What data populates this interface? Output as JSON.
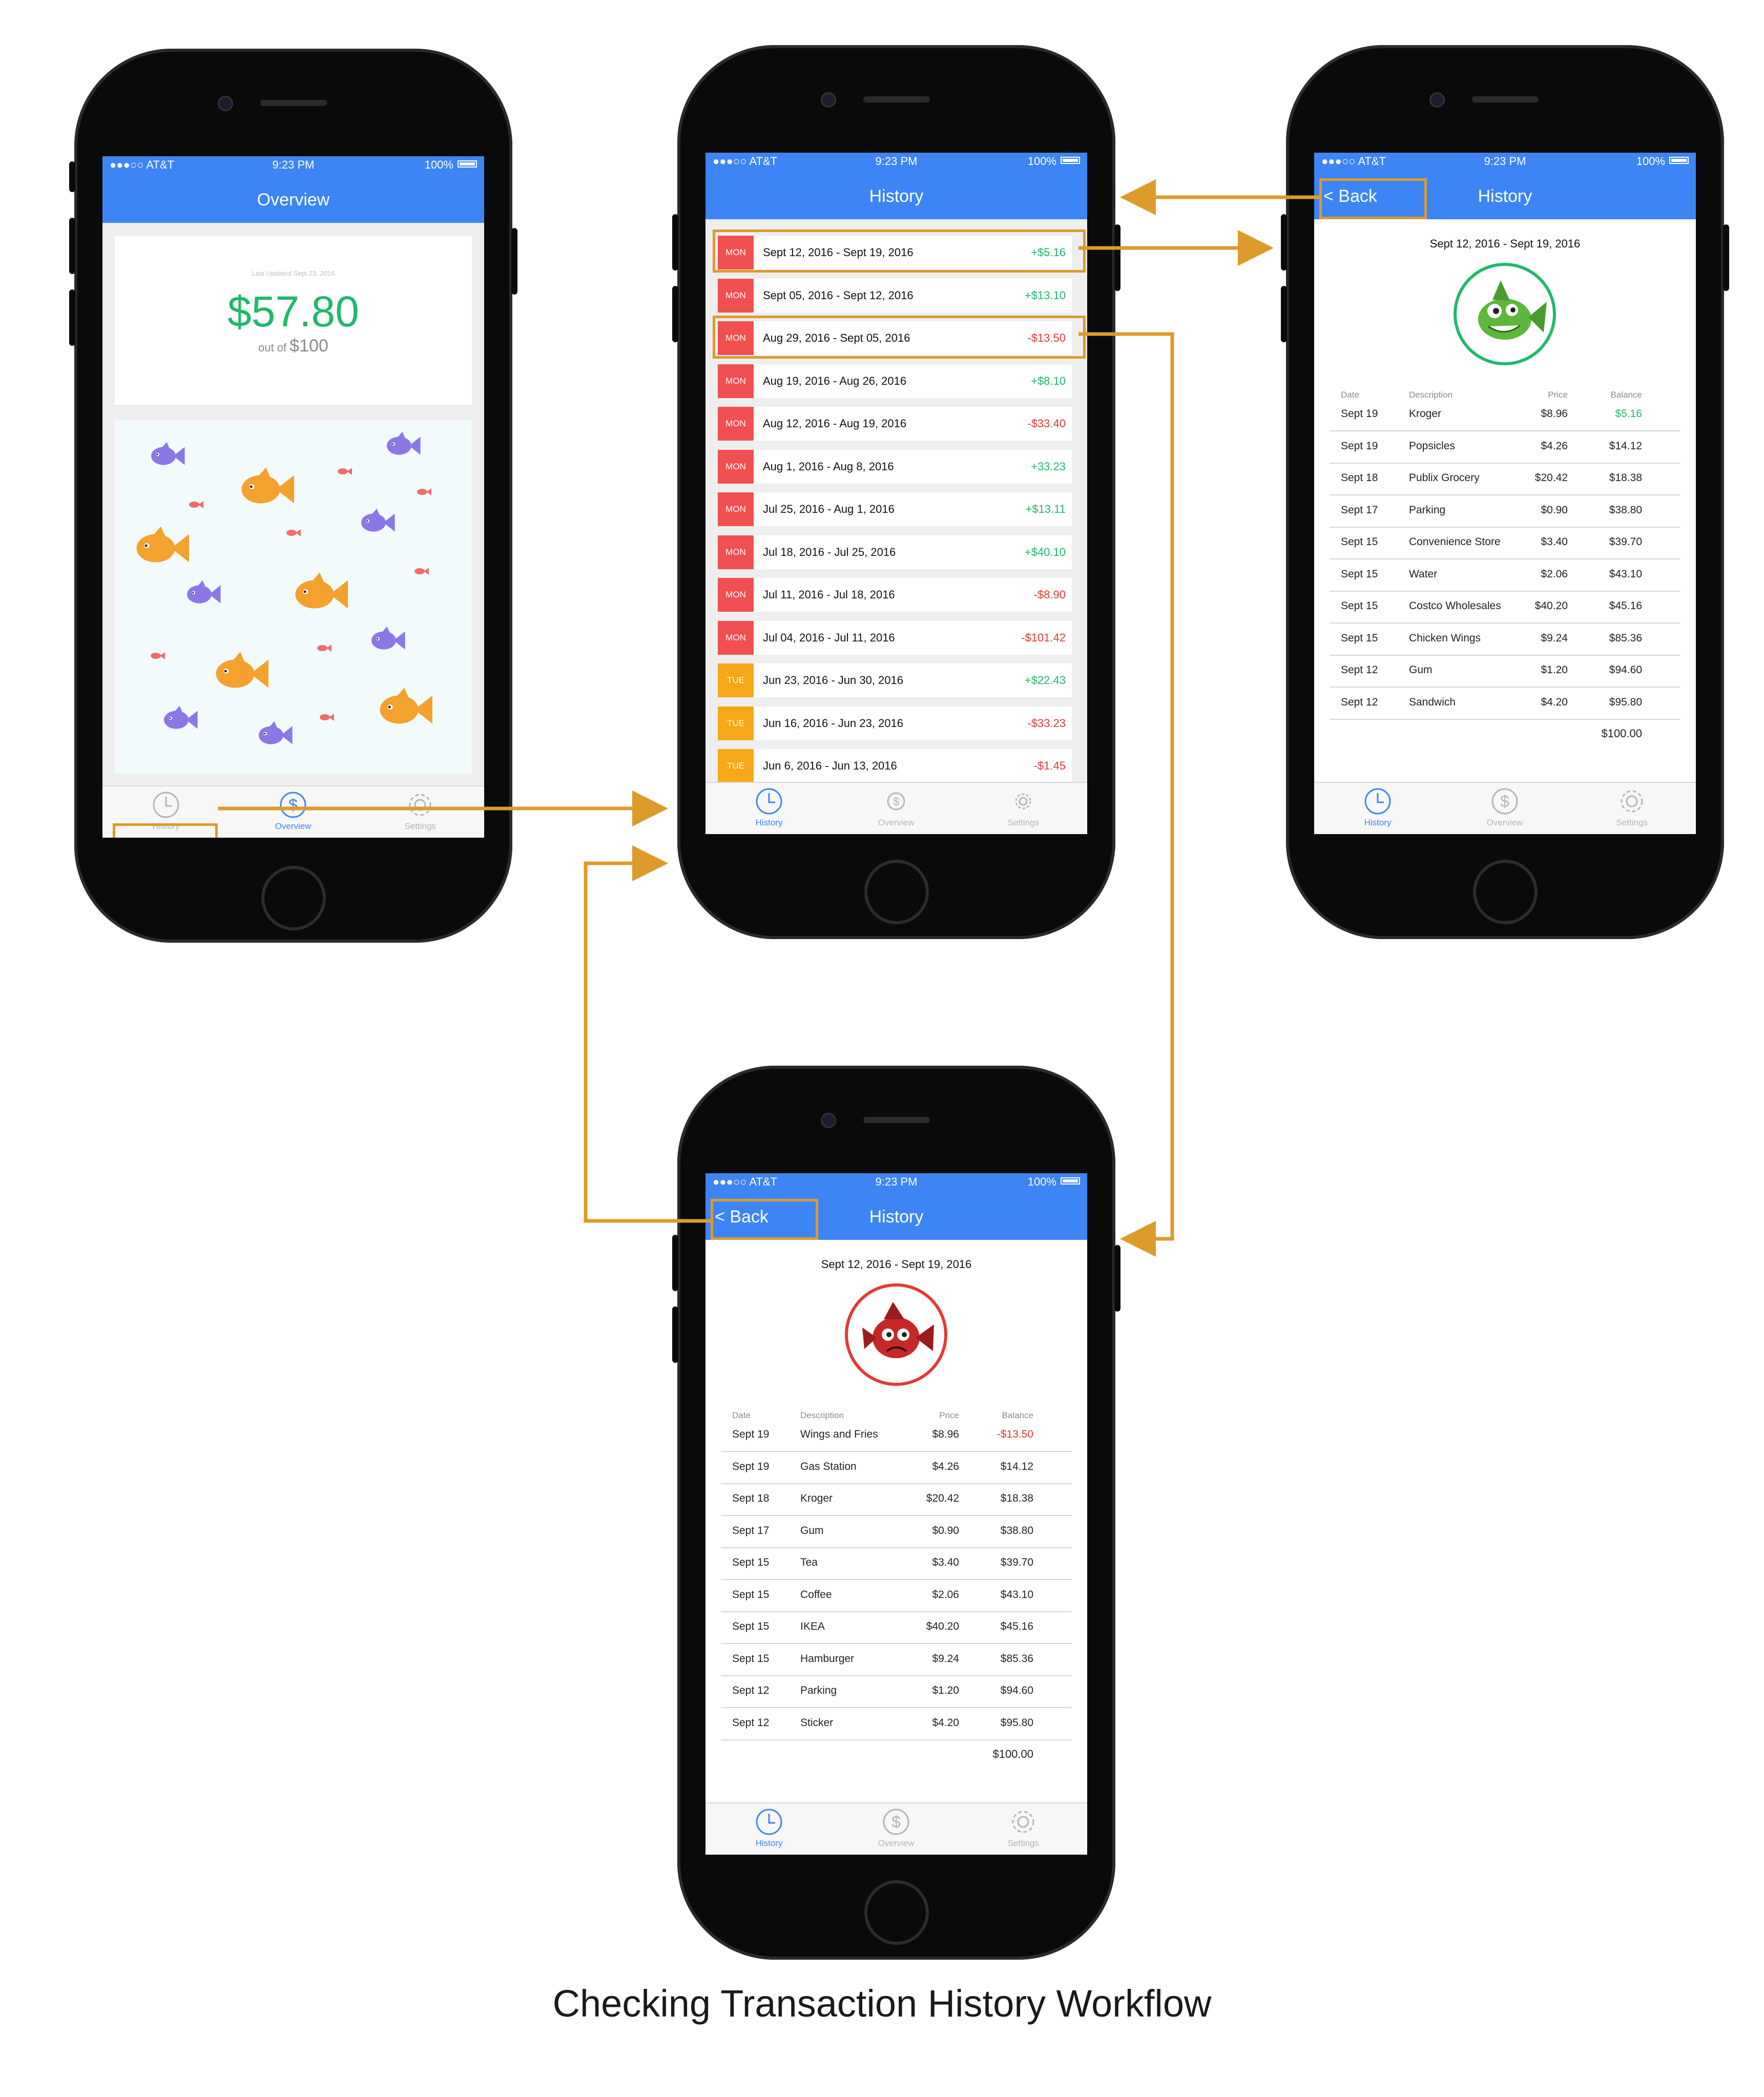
{
  "caption": "Checking Transaction History Workflow",
  "colors": {
    "accent": "#3d85f5",
    "highlight": "#dc9b2b",
    "positive": "#22b86b",
    "negative": "#e53935",
    "mon": "#f05050",
    "tue": "#f7a818"
  },
  "statusbar": {
    "carrier": "●●●○○ AT&T",
    "time": "9:23 PM",
    "battery": "100%"
  },
  "tabs": {
    "history": "History",
    "overview": "Overview",
    "settings": "Settings"
  },
  "overview": {
    "title": "Overview",
    "updated": "Last Updated Sept 23, 2016",
    "amount": "$57.80",
    "outof_prefix": "out of",
    "outof_value": "$100"
  },
  "history": {
    "title": "History",
    "rows": [
      {
        "day": "MON",
        "range": "Sept 12, 2016 - Sept 19, 2016",
        "amount": "+$5.16",
        "sign": "pos"
      },
      {
        "day": "MON",
        "range": "Sept 05, 2016 - Sept 12, 2016",
        "amount": "+$13.10",
        "sign": "pos"
      },
      {
        "day": "MON",
        "range": "Aug 29, 2016 - Sept 05, 2016",
        "amount": "-$13.50",
        "sign": "neg"
      },
      {
        "day": "MON",
        "range": "Aug 19, 2016 - Aug 26, 2016",
        "amount": "+$8.10",
        "sign": "pos"
      },
      {
        "day": "MON",
        "range": "Aug 12, 2016 - Aug 19, 2016",
        "amount": "-$33.40",
        "sign": "neg"
      },
      {
        "day": "MON",
        "range": "Aug 1, 2016 - Aug 8, 2016",
        "amount": "+33.23",
        "sign": "pos"
      },
      {
        "day": "MON",
        "range": "Jul 25, 2016 - Aug 1, 2016",
        "amount": "+$13.11",
        "sign": "pos"
      },
      {
        "day": "MON",
        "range": "Jul 18, 2016 - Jul 25, 2016",
        "amount": "+$40.10",
        "sign": "pos"
      },
      {
        "day": "MON",
        "range": "Jul 11, 2016 - Jul 18, 2016",
        "amount": "-$8.90",
        "sign": "neg"
      },
      {
        "day": "MON",
        "range": "Jul 04, 2016 - Jul 11, 2016",
        "amount": "-$101.42",
        "sign": "neg"
      },
      {
        "day": "TUE",
        "range": "Jun 23, 2016 - Jun 30, 2016",
        "amount": "+$22.43",
        "sign": "pos"
      },
      {
        "day": "TUE",
        "range": "Jun 16, 2016 - Jun 23, 2016",
        "amount": "-$33.23",
        "sign": "neg"
      },
      {
        "day": "TUE",
        "range": "Jun 6, 2016 - Jun 13, 2016",
        "amount": "-$1.45",
        "sign": "neg"
      }
    ]
  },
  "detail_positive": {
    "back": "< Back",
    "title": "History",
    "date_range": "Sept 12, 2016 - Sept 19, 2016",
    "headers": [
      "Date",
      "Description",
      "Price",
      "Balance"
    ],
    "rows": [
      {
        "date": "Sept 19",
        "desc": "Kroger",
        "price": "$8.96",
        "balance": "$5.16",
        "highlight": "pos"
      },
      {
        "date": "Sept 19",
        "desc": "Popsicles",
        "price": "$4.26",
        "balance": "$14.12"
      },
      {
        "date": "Sept 18",
        "desc": "Publix Grocery",
        "price": "$20.42",
        "balance": "$18.38"
      },
      {
        "date": "Sept 17",
        "desc": "Parking",
        "price": "$0.90",
        "balance": "$38.80"
      },
      {
        "date": "Sept 15",
        "desc": "Convenience Store",
        "price": "$3.40",
        "balance": "$39.70"
      },
      {
        "date": "Sept 15",
        "desc": "Water",
        "price": "$2.06",
        "balance": "$43.10"
      },
      {
        "date": "Sept 15",
        "desc": "Costco Wholesales",
        "price": "$40.20",
        "balance": "$45.16"
      },
      {
        "date": "Sept 15",
        "desc": "Chicken Wings",
        "price": "$9.24",
        "balance": "$85.36"
      },
      {
        "date": "Sept 12",
        "desc": "Gum",
        "price": "$1.20",
        "balance": "$94.60"
      },
      {
        "date": "Sept 12",
        "desc": "Sandwich",
        "price": "$4.20",
        "balance": "$95.80"
      }
    ],
    "total": "$100.00"
  },
  "detail_negative": {
    "back": "< Back",
    "title": "History",
    "date_range": "Sept 12, 2016 - Sept 19, 2016",
    "headers": [
      "Date",
      "Description",
      "Price",
      "Balance"
    ],
    "rows": [
      {
        "date": "Sept 19",
        "desc": "Wings and Fries",
        "price": "$8.96",
        "balance": "-$13.50",
        "highlight": "neg"
      },
      {
        "date": "Sept 19",
        "desc": "Gas Station",
        "price": "$4.26",
        "balance": "$14.12"
      },
      {
        "date": "Sept 18",
        "desc": "Kroger",
        "price": "$20.42",
        "balance": "$18.38"
      },
      {
        "date": "Sept 17",
        "desc": "Gum",
        "price": "$0.90",
        "balance": "$38.80"
      },
      {
        "date": "Sept 15",
        "desc": "Tea",
        "price": "$3.40",
        "balance": "$39.70"
      },
      {
        "date": "Sept 15",
        "desc": "Coffee",
        "price": "$2.06",
        "balance": "$43.10"
      },
      {
        "date": "Sept 15",
        "desc": "IKEA",
        "price": "$40.20",
        "balance": "$45.16"
      },
      {
        "date": "Sept 15",
        "desc": "Hamburger",
        "price": "$9.24",
        "balance": "$85.36"
      },
      {
        "date": "Sept 12",
        "desc": "Parking",
        "price": "$1.20",
        "balance": "$94.60"
      },
      {
        "date": "Sept 12",
        "desc": "Sticker",
        "price": "$4.20",
        "balance": "$95.80"
      }
    ],
    "total": "$100.00"
  }
}
